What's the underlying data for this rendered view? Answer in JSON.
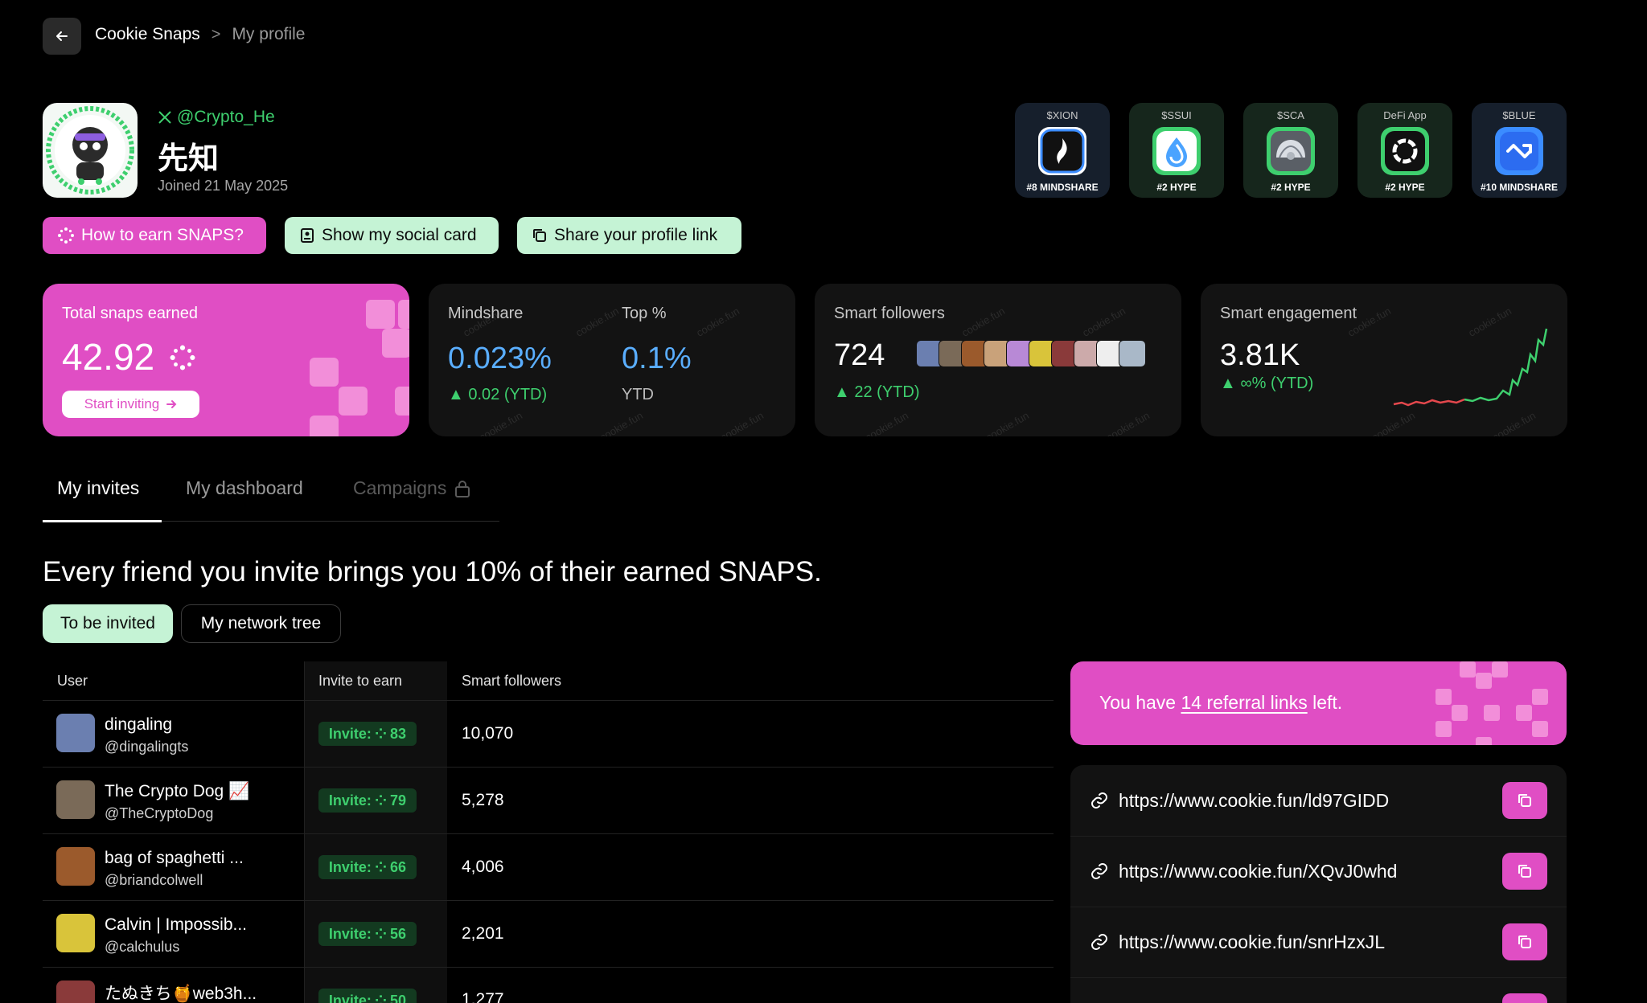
{
  "breadcrumb": {
    "app": "Cookie Snaps",
    "separator": ">",
    "current": "My profile"
  },
  "profile": {
    "handle": "@Crypto_He",
    "name": "先知",
    "joined": "Joined 21 May 2025"
  },
  "actions": {
    "earn": "How to earn SNAPS?",
    "social_card": "Show my social card",
    "share_link": "Share your profile link"
  },
  "badges": [
    {
      "symbol": "$XION",
      "rank": "#8 MINDSHARE",
      "color": "#1c2b55",
      "icon": "xion-icon"
    },
    {
      "symbol": "$SSUI",
      "rank": "#2 HYPE",
      "color": "#16331f",
      "icon": "sui-drop-icon"
    },
    {
      "symbol": "$SCA",
      "rank": "#2 HYPE",
      "color": "#16331f",
      "icon": "shell-icon"
    },
    {
      "symbol": "DeFi App",
      "rank": "#2 HYPE",
      "color": "#16331f",
      "icon": "ring-icon"
    },
    {
      "symbol": "$BLUE",
      "rank": "#10 MINDSHARE",
      "color": "#1c2b55",
      "icon": "bluefin-icon"
    }
  ],
  "stats": {
    "snaps": {
      "label": "Total snaps earned",
      "value": "42.92",
      "button": "Start inviting"
    },
    "mindshare": {
      "label": "Mindshare",
      "value": "0.023%",
      "change": "0.02 (YTD)"
    },
    "top": {
      "label": "Top %",
      "value": "0.1%",
      "period": "YTD"
    },
    "followers": {
      "label": "Smart followers",
      "value": "724",
      "change": "22 (YTD)"
    },
    "engagement": {
      "label": "Smart engagement",
      "value": "3.81K",
      "change": "∞% (YTD)"
    },
    "watermark": "cookie.fun"
  },
  "tabs": {
    "invites": "My invites",
    "dashboard": "My dashboard",
    "campaigns": "Campaigns"
  },
  "headline": "Every friend you invite brings you 10% of their earned SNAPS.",
  "segments": {
    "to_invite": "To be invited",
    "tree": "My network tree"
  },
  "table": {
    "headers": {
      "user": "User",
      "invite": "Invite to earn",
      "followers": "Smart followers"
    },
    "invite_prefix": "Invite:",
    "rows": [
      {
        "name": "dingaling",
        "handle": "@dingalingts",
        "invite": "83",
        "followers": "10,070",
        "avatar_color": "#6b7fb0"
      },
      {
        "name": "The Crypto Dog 📈",
        "handle": "@TheCryptoDog",
        "invite": "79",
        "followers": "5,278",
        "avatar_color": "#7a6a58"
      },
      {
        "name": "bag of spaghetti ...",
        "handle": "@briandcolwell",
        "invite": "66",
        "followers": "4,006",
        "avatar_color": "#9b5a2c"
      },
      {
        "name": "Calvin | Impossib...",
        "handle": "@calchulus",
        "invite": "56",
        "followers": "2,201",
        "avatar_color": "#d9c43a"
      },
      {
        "name": "たぬきち🍯web3h...",
        "handle": "",
        "invite": "50",
        "followers": "1,277",
        "avatar_color": "#8a3a3a"
      }
    ]
  },
  "referral": {
    "prefix": "You have ",
    "count_text": "14 referral links",
    "suffix": " left.",
    "links": [
      "https://www.cookie.fun/ld97GIDD",
      "https://www.cookie.fun/XQvJ0whd",
      "https://www.cookie.fun/snrHzxJL"
    ]
  },
  "colors": {
    "pink": "#e04ec4",
    "mint": "#c5f3d5",
    "green": "#3ecf6e",
    "blue": "#5aaeff"
  }
}
